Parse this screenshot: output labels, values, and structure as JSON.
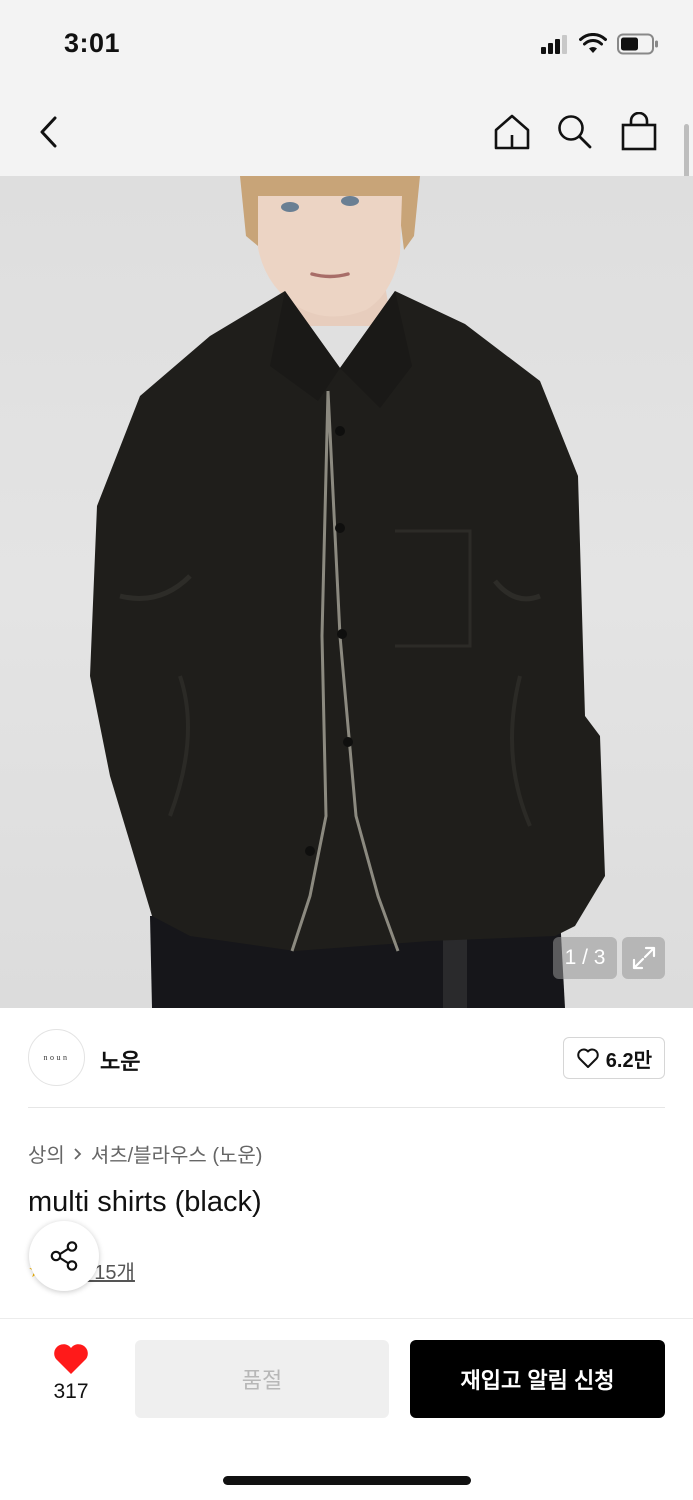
{
  "status_bar": {
    "time": "3:01"
  },
  "nav": {
    "back": "back-icon",
    "home": "home-icon",
    "search": "search-icon",
    "cart": "shopping-bag-icon"
  },
  "gallery": {
    "counter": "1 / 3",
    "expand": "expand-icon"
  },
  "brand": {
    "logo_text": "noun",
    "name": "노운",
    "likes": "6.2만"
  },
  "product": {
    "breadcrumb": [
      "상의",
      "셔츠/블라우스 (노운)"
    ],
    "title": "multi shirts (black)",
    "review_link": "후기 15개"
  },
  "bottom": {
    "wish_count": "317",
    "soldout_label": "품절",
    "restock_label": "재입고 알림 신청"
  },
  "colors": {
    "accent_red": "#ff1a1a",
    "primary_black": "#000000",
    "disabled_bg": "#efefef"
  }
}
